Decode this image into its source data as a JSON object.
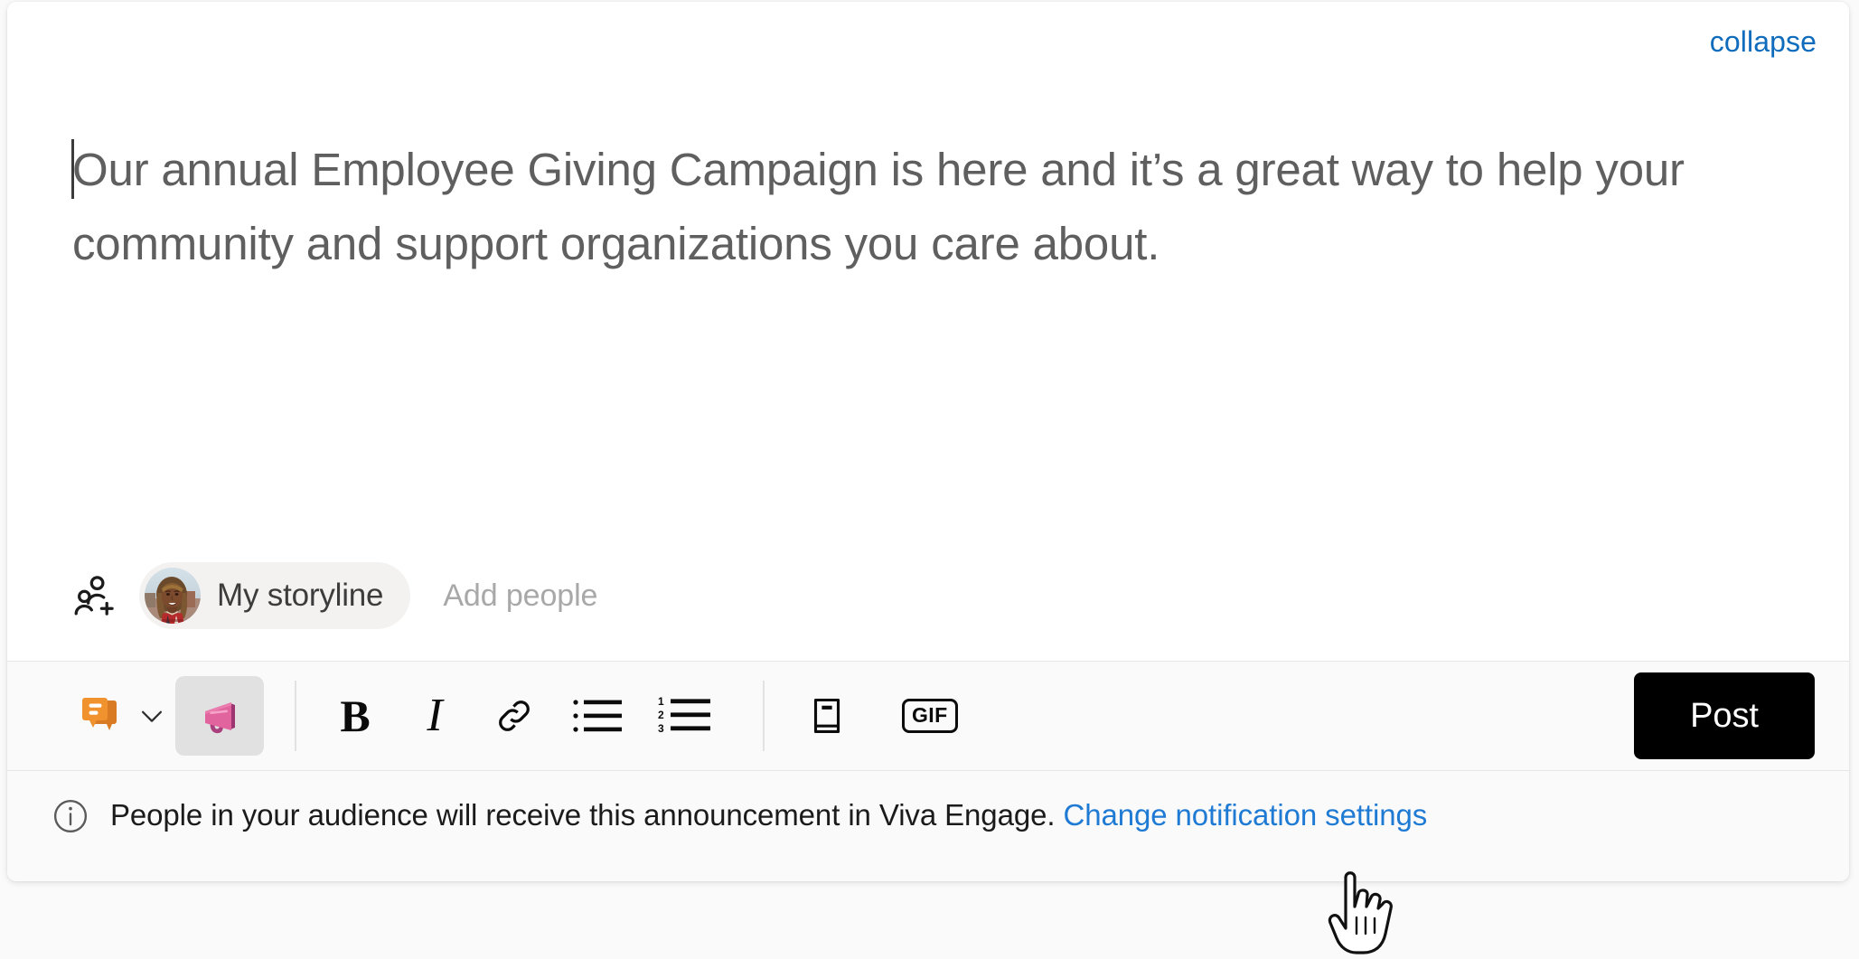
{
  "card": {
    "collapse_label": "collapse",
    "post_text": "Our annual Employee Giving Campaign is here and it’s a great way to help your community and support organizations you care about."
  },
  "audience": {
    "add_people_icon": "add-people-icon",
    "chip_label": "My storyline",
    "add_people_placeholder": "Add people"
  },
  "toolbar": {
    "items": [
      {
        "name": "post-type-discussion-icon",
        "kind": "icon",
        "label": "discussion",
        "selected": false
      },
      {
        "name": "post-type-chevron-down-icon",
        "kind": "chevron",
        "label": "",
        "selected": false
      },
      {
        "name": "post-type-announcement-icon",
        "kind": "icon",
        "label": "announcement",
        "selected": true
      },
      {
        "name": "toolbar-divider-1",
        "kind": "divider",
        "label": "",
        "selected": false
      },
      {
        "name": "bold-button",
        "kind": "text",
        "label": "B",
        "selected": false
      },
      {
        "name": "italic-button",
        "kind": "text",
        "label": "I",
        "selected": false
      },
      {
        "name": "link-button",
        "kind": "icon",
        "label": "link",
        "selected": false
      },
      {
        "name": "bulleted-list-button",
        "kind": "icon",
        "label": "bulleted-list",
        "selected": false
      },
      {
        "name": "numbered-list-button",
        "kind": "icon",
        "label": "numbered-list",
        "selected": false
      },
      {
        "name": "toolbar-divider-2",
        "kind": "divider",
        "label": "",
        "selected": false
      },
      {
        "name": "media-button",
        "kind": "icon",
        "label": "book",
        "selected": false
      },
      {
        "name": "gif-button",
        "kind": "text",
        "label": "GIF",
        "selected": false
      }
    ],
    "numbered_list_digits": [
      "1",
      "2",
      "3"
    ],
    "gif_label": "GIF",
    "bold_label": "B",
    "italic_label": "I",
    "post_label": "Post"
  },
  "notice": {
    "icon": "info-icon",
    "text": "People in your audience will receive this announcement in Viva Engage.",
    "link_label": "Change notification settings"
  },
  "cursor": {
    "type": "pointing-hand-cursor"
  },
  "colors": {
    "link_blue": "#0f6cbd",
    "notice_link_blue": "#1f7ad4",
    "body_text_gray": "#5f5f5f",
    "post_button_bg": "#000000",
    "post_button_fg": "#ffffff",
    "discussion_orange": "#f0932f",
    "discussion_orange_dark": "#d97b22",
    "announcement_pink": "#e2649f",
    "announcement_pink_dark": "#a93f7c",
    "selected_chip_bg": "#e1e1e1",
    "chip_bg": "#f3f2f1",
    "toolbar_bg": "#fafafa",
    "card_bg": "#ffffff",
    "placeholder_gray": "#a8a8a8"
  }
}
